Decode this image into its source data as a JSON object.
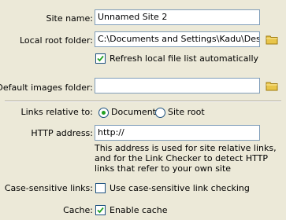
{
  "site_name": {
    "label": "Site name:",
    "value": "Unnamed Site 2"
  },
  "local_root": {
    "label": "Local root folder:",
    "value": "C:\\Documents and Settings\\Kadu\\Desktop"
  },
  "refresh": {
    "label": "Refresh local file list automatically",
    "checked": true
  },
  "default_images": {
    "label": "Default images folder:",
    "value": ""
  },
  "links_relative": {
    "label": "Links relative to:",
    "option_document": "Document",
    "option_site_root": "Site root",
    "selected": "Document"
  },
  "http": {
    "label": "HTTP address:",
    "value": "http://",
    "help": "This address is used for site relative links, and for the Link Checker to detect HTTP links that refer to your own site"
  },
  "case_sensitive": {
    "label": "Case-sensitive links:",
    "option": "Use case-sensitive link checking",
    "checked": false
  },
  "cache": {
    "label": "Cache:",
    "option": "Enable cache",
    "checked": true
  },
  "icons": {
    "folder": "folder-icon",
    "check": "checkmark-icon"
  },
  "colors": {
    "background": "#ece9d8",
    "folder": "#e8c54a",
    "field_border": "#7f9db9",
    "radio_dot": "#21a121"
  }
}
